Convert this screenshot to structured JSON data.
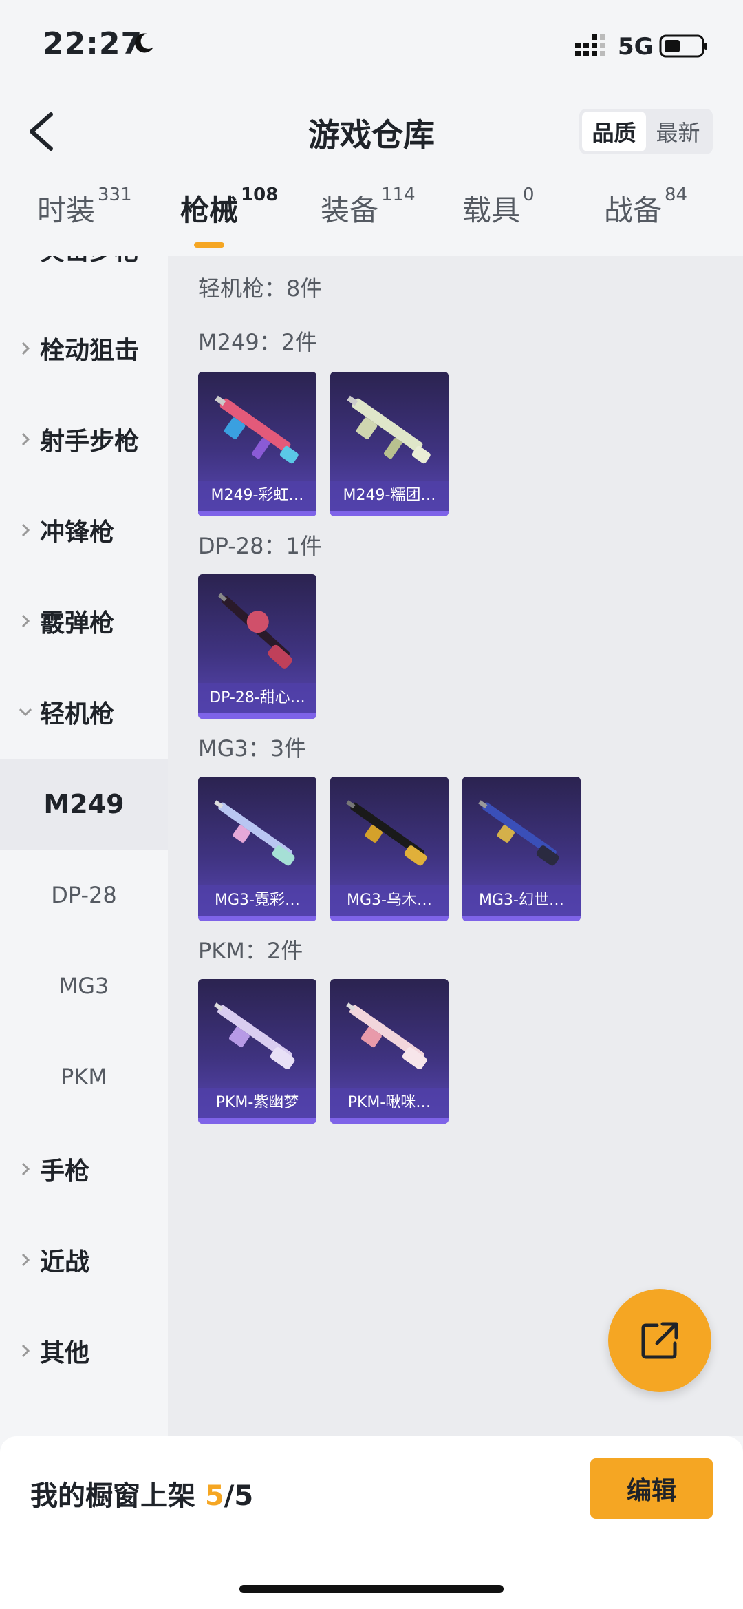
{
  "status_bar": {
    "time": "22:27",
    "network": "5G"
  },
  "header": {
    "title": "游戏仓库",
    "sort_options": [
      "品质",
      "最新"
    ],
    "sort_selected": "品质"
  },
  "tabs": [
    {
      "label": "时装",
      "count": "331"
    },
    {
      "label": "枪械",
      "count": "108",
      "active": true
    },
    {
      "label": "装备",
      "count": "114"
    },
    {
      "label": "载具",
      "count": "0"
    },
    {
      "label": "战备",
      "count": "84"
    }
  ],
  "sidebar": {
    "partial_top": "突击步枪",
    "categories": [
      "栓动狙击",
      "射手步枪",
      "冲锋枪",
      "霰弹枪",
      "轻机枪"
    ],
    "subcategories": [
      "M249",
      "DP-28",
      "MG3",
      "PKM"
    ],
    "active_sub": "M249",
    "categories_after": [
      "手枪",
      "近战",
      "其他"
    ]
  },
  "content": {
    "summary": "轻机枪：8件",
    "groups": [
      {
        "header": "M249：2件",
        "items": [
          "M249-彩虹…",
          "M249-糯团…"
        ]
      },
      {
        "header": "DP-28：1件",
        "items": [
          "DP-28-甜心…"
        ]
      },
      {
        "header": "MG3：3件",
        "items": [
          "MG3-霓彩…",
          "MG3-乌木…",
          "MG3-幻世…"
        ]
      },
      {
        "header": "PKM：2件",
        "items": [
          "PKM-紫幽梦",
          "PKM-啾咪…"
        ]
      }
    ]
  },
  "bottom": {
    "shelf_label": "我的橱窗上架 ",
    "shelf_count": "5",
    "shelf_total": "/5",
    "edit_label": "编辑"
  },
  "colors": {
    "accent": "#f5a623",
    "card_bg": "#3f3380",
    "card_label_bg": "#5040aa"
  }
}
